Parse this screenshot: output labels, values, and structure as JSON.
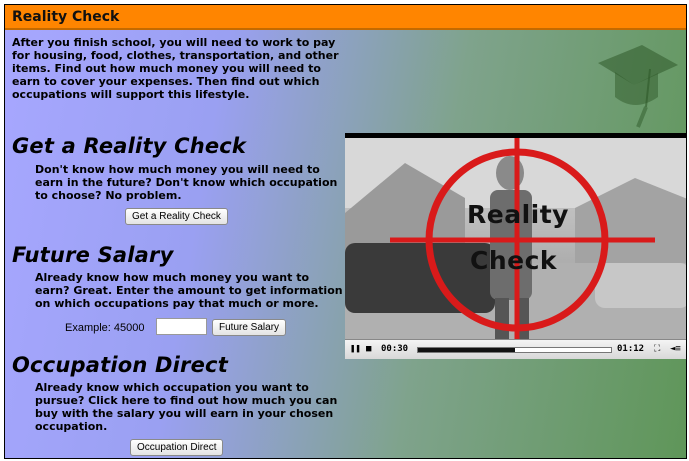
{
  "header": {
    "title": "Reality Check"
  },
  "intro": "After you finish school, you will need to work to pay for housing, food, clothes, transportation, and other items. Find out how much money you will need to earn to cover your expenses. Then find out which occupations will support this lifestyle.",
  "sections": [
    {
      "title": "Get a Reality Check",
      "text": "Don't know how much money you will need to earn in the future? Don't know which occupation to choose? No problem.",
      "button_label": "Get a Reality Check"
    },
    {
      "title": "Future Salary",
      "text": "Already know how much money you want to earn? Great. Enter the amount to get information on which occupations pay that much or more.",
      "example_label": "Example: 45000",
      "input_value": "",
      "button_label": "Future Salary"
    },
    {
      "title": "Occupation Direct",
      "text": "Already know which occupation you want to pursue? Click here to find out how much you can buy with the salary you will earn in your chosen occupation.",
      "button_label": "Occupation Direct"
    }
  ],
  "video": {
    "overlay_line1": "Reality",
    "overlay_line2": "Check",
    "current_time": "00:30",
    "duration": "01:12",
    "progress": 0.5,
    "crosshair_color": "#d91a1a"
  },
  "colors": {
    "title_bar": "#ff8500",
    "background_left": "#a7a7ff",
    "background_right": "#5f9659"
  },
  "icons": {
    "graduation_cap": "graduation-cap-icon",
    "play_pause": "pause-icon",
    "stop": "stop-icon",
    "fullscreen": "fullscreen-icon",
    "volume": "volume-icon"
  }
}
